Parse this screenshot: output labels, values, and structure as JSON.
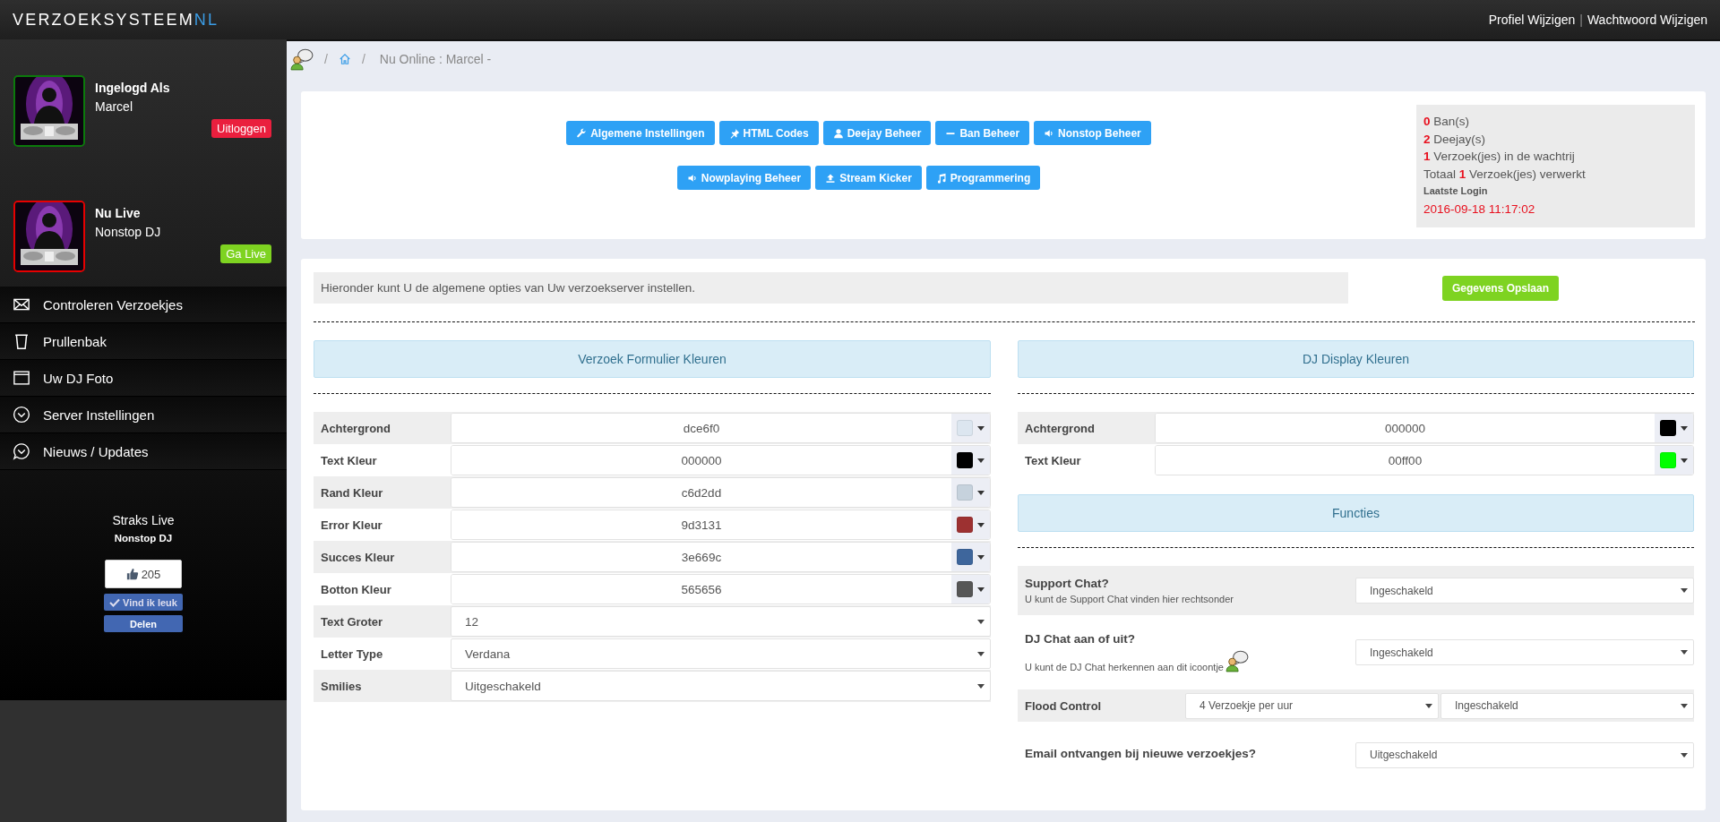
{
  "brand": {
    "name": "VERZOEKSYSTEEM",
    "suffix": "NL"
  },
  "top_links": {
    "items": [
      "Profiel Wijzigen",
      "Wachtwoord Wijzigen"
    ],
    "separator": "|"
  },
  "sidebar": {
    "profiles": [
      {
        "title": "Ingelogd Als",
        "name": "Marcel",
        "color": "#0b7a0b",
        "button": {
          "label": "Uitloggen",
          "kind": "danger"
        }
      },
      {
        "title": "Nu Live",
        "name": "Nonstop DJ",
        "color": "#e60000",
        "button": {
          "label": "Ga Live",
          "kind": "success"
        }
      }
    ],
    "menu": [
      {
        "label": "Controleren Verzoekjes",
        "kind": "envelope"
      },
      {
        "label": "Prullenbak",
        "kind": "trash"
      },
      {
        "label": "Uw DJ Foto",
        "kind": "window"
      },
      {
        "label": "Server Instellingen",
        "kind": "chevron"
      },
      {
        "label": "Nieuws / Updates",
        "kind": "chat"
      }
    ],
    "next": {
      "title": "Straks Live",
      "name": "Nonstop DJ"
    },
    "like": {
      "count": "205",
      "like_label": "Vind ik leuk",
      "share_label": "Delen"
    }
  },
  "breadcrumb": {
    "separator": "/",
    "text": "Nu Online : Marcel -"
  },
  "toolbar": {
    "buttons": [
      {
        "label": "Algemene Instellingen",
        "kind": "wrench"
      },
      {
        "label": "HTML Codes",
        "kind": "pin"
      },
      {
        "label": "Deejay Beheer",
        "kind": "user"
      },
      {
        "label": "Ban Beheer",
        "kind": "minus"
      },
      {
        "label": "Nonstop Beheer",
        "kind": "volume"
      },
      {
        "label": "Nowplaying Beheer",
        "kind": "volume"
      },
      {
        "label": "Stream Kicker",
        "kind": "upload"
      },
      {
        "label": "Programmering",
        "kind": "music"
      }
    ]
  },
  "stats": {
    "lines": [
      {
        "count": "0",
        "label": "Ban(s)"
      },
      {
        "count": "2",
        "label": "Deejay(s)"
      },
      {
        "count": "1",
        "label": "Verzoek(jes) in de wachtrij"
      },
      {
        "prefix": "Totaal",
        "count": "1",
        "label": "Verzoek(jes) verwerkt"
      }
    ],
    "last_login_label": "Laatste Login",
    "last_login": "2016-09-18 11:17:02"
  },
  "settings": {
    "intro": "Hieronder kunt U de algemene opties van Uw verzoekserver instellen.",
    "save_button": "Gegevens Opslaan",
    "left": {
      "heading": "Verzoek Formulier Kleuren",
      "rows": [
        {
          "kind": "color",
          "label": "Achtergrond",
          "value": "dce6f0",
          "color": "#dce6f0"
        },
        {
          "kind": "color",
          "label": "Text Kleur",
          "value": "000000",
          "color": "#000000"
        },
        {
          "kind": "color",
          "label": "Rand Kleur",
          "value": "c6d2dd",
          "color": "#c6d2dd"
        },
        {
          "kind": "color",
          "label": "Error Kleur",
          "value": "9d3131",
          "color": "#9d3131"
        },
        {
          "kind": "color",
          "label": "Succes Kleur",
          "value": "3e669c",
          "color": "#3e669c"
        },
        {
          "kind": "color",
          "label": "Botton Kleur",
          "value": "565656",
          "color": "#565656"
        },
        {
          "kind": "select",
          "label": "Text Groter",
          "value": "12"
        },
        {
          "kind": "select",
          "label": "Letter Type",
          "value": "Verdana"
        },
        {
          "kind": "select",
          "label": "Smilies",
          "value": "Uitgeschakeld"
        }
      ]
    },
    "right": {
      "heading": "DJ Display Kleuren",
      "rows": [
        {
          "kind": "color",
          "label": "Achtergrond",
          "value": "000000",
          "color": "#000000"
        },
        {
          "kind": "color",
          "label": "Text Kleur",
          "value": "00ff00",
          "color": "#00ff00"
        }
      ]
    },
    "functions": {
      "heading": "Functies",
      "rows": [
        {
          "kind": "wide",
          "label": "Support Chat?",
          "hint": "U kunt de Support Chat vinden hier rechtsonder",
          "values": [
            "Ingeschakeld"
          ]
        },
        {
          "kind": "wide",
          "label": "DJ Chat aan of uit?",
          "hint": "U kunt de DJ Chat herkennen aan dit icoontje",
          "hint_icon": true,
          "values": [
            "Ingeschakeld"
          ]
        },
        {
          "kind": "pair",
          "label": "Flood Control",
          "values": [
            "4 Verzoekje per uur",
            "Ingeschakeld"
          ]
        },
        {
          "kind": "wide",
          "label": "Email ontvangen bij nieuwe verzoekjes?",
          "values": [
            "Uitgeschakeld"
          ]
        }
      ]
    }
  }
}
